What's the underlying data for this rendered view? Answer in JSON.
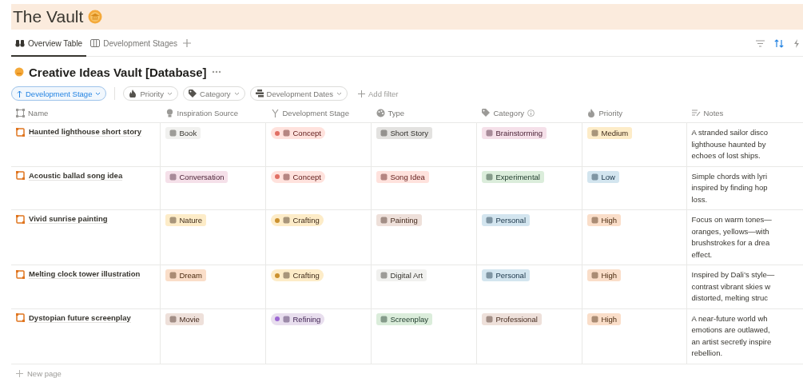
{
  "page": {
    "title": "The Vault"
  },
  "tabs": [
    {
      "label": "Overview Table",
      "selected": true
    },
    {
      "label": "Development Stages",
      "selected": false
    }
  ],
  "database": {
    "title": "Creative Ideas Vault [Database]"
  },
  "filters": [
    {
      "label": "Development Stage",
      "kind": "sort"
    },
    {
      "label": "Priority",
      "kind": "filter"
    },
    {
      "label": "Category",
      "kind": "filter"
    },
    {
      "label": "Development Dates",
      "kind": "filter"
    },
    {
      "label": "Add filter",
      "kind": "add"
    }
  ],
  "table": {
    "columns": [
      "Name",
      "Inspiration Source",
      "Development Stage",
      "Type",
      "Category",
      "Priority",
      "Notes"
    ],
    "rows": [
      {
        "name": "Haunted lighthouse short story",
        "inspiration": {
          "label": "Book",
          "color": "#f1f1ef"
        },
        "stage": {
          "label": "Concept",
          "color": "#ffe2dd",
          "dot": {
            "color": "#e16f64"
          }
        },
        "type": {
          "label": "Short Story",
          "color": "#e3e2e0"
        },
        "category": {
          "label": "Brainstorming",
          "color": "#f5e0e9"
        },
        "priority": {
          "label": "Medium",
          "color": "#fdecc8"
        },
        "notes": [
          "A stranded sailor disco",
          "lighthouse haunted by",
          "echoes of lost ships."
        ]
      },
      {
        "name": "Acoustic ballad song idea",
        "inspiration": {
          "label": "Conversation",
          "color": "#f5e0e9"
        },
        "stage": {
          "label": "Concept",
          "color": "#ffe2dd",
          "dot": {
            "color": "#e16f64"
          }
        },
        "type": {
          "label": "Song Idea",
          "color": "#ffe2dd"
        },
        "category": {
          "label": "Experimental",
          "color": "#dbeddb"
        },
        "priority": {
          "label": "Low",
          "color": "#d3e5ef"
        },
        "notes": [
          "Simple chords with lyri",
          "inspired by finding hop",
          "loss."
        ]
      },
      {
        "name": "Vivid sunrise painting",
        "inspiration": {
          "label": "Nature",
          "color": "#fdecc8"
        },
        "stage": {
          "label": "Crafting",
          "color": "#fdecc8",
          "dot": {
            "color": "#cb912f"
          }
        },
        "type": {
          "label": "Painting",
          "color": "#eee0da"
        },
        "category": {
          "label": "Personal",
          "color": "#d3e5ef"
        },
        "priority": {
          "label": "High",
          "color": "#fadec9"
        },
        "notes": [
          "Focus on warm tones—",
          "oranges, yellows—with",
          "brushstrokes for a drea",
          "effect."
        ]
      },
      {
        "name": "Melting clock tower illustration",
        "inspiration": {
          "label": "Dream",
          "color": "#fadec9"
        },
        "stage": {
          "label": "Crafting",
          "color": "#fdecc8",
          "dot": {
            "color": "#cb912f"
          }
        },
        "type": {
          "label": "Digital Art",
          "color": "#f1f1ef"
        },
        "category": {
          "label": "Personal",
          "color": "#d3e5ef"
        },
        "priority": {
          "label": "High",
          "color": "#fadec9"
        },
        "notes": [
          "Inspired by Dali’s style—",
          "contrast vibrant skies w",
          "distorted, melting struc"
        ]
      },
      {
        "name": "Dystopian future screenplay",
        "inspiration": {
          "label": "Movie",
          "color": "#eee0da"
        },
        "stage": {
          "label": "Refining",
          "color": "#e8deee",
          "dot": {
            "color": "#9d68d3"
          }
        },
        "type": {
          "label": "Screenplay",
          "color": "#dbeddb"
        },
        "category": {
          "label": "Professional",
          "color": "#eee0da"
        },
        "priority": {
          "label": "High",
          "color": "#fadec9"
        },
        "notes": [
          "A near-future world wh",
          "emotions are outlawed,",
          "an artist secretly inspire",
          "rebellion."
        ]
      }
    ]
  },
  "new_page": "New page"
}
